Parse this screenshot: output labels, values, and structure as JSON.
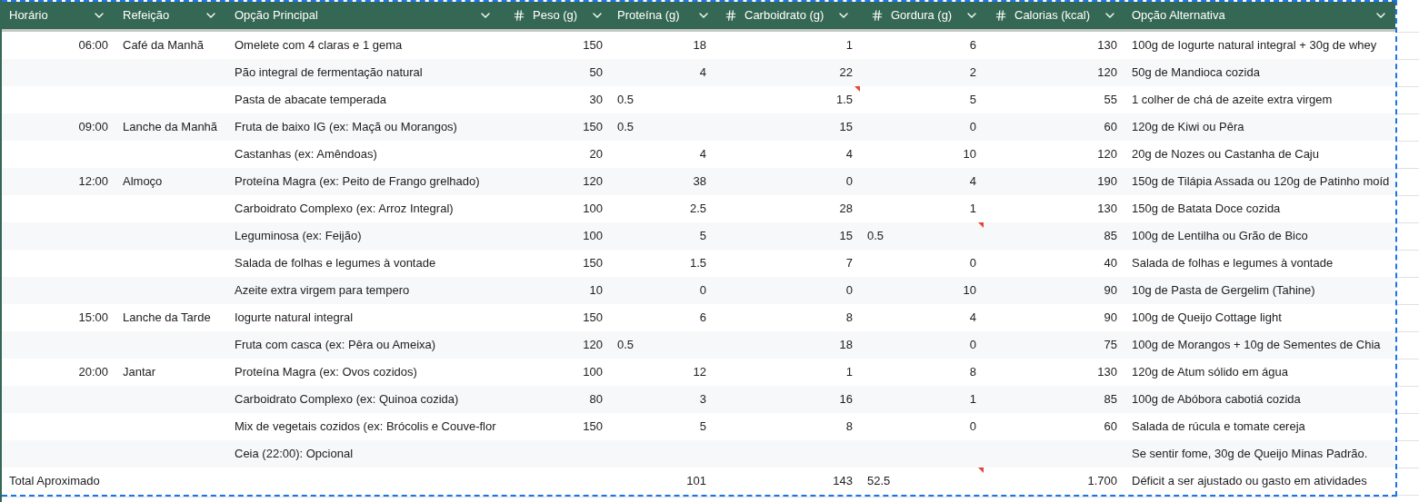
{
  "columns": [
    {
      "label": "Horário",
      "numeric": false
    },
    {
      "label": "Refeição",
      "numeric": false
    },
    {
      "label": "Opção Principal",
      "numeric": false
    },
    {
      "label": "Peso (g)",
      "numeric": true
    },
    {
      "label": "Proteína (g)",
      "numeric": false
    },
    {
      "label": "Carboidrato (g)",
      "numeric": true
    },
    {
      "label": "Gordura (g)",
      "numeric": true
    },
    {
      "label": "Calorias (kcal)",
      "numeric": true
    },
    {
      "label": "Opção Alternativa",
      "numeric": false
    }
  ],
  "rows": [
    {
      "cells": [
        {
          "text": "06:00",
          "kind": "number",
          "note": false
        },
        {
          "text": "Café da Manhã",
          "kind": "text",
          "note": false
        },
        {
          "text": "Omelete com 4 claras e 1 gema",
          "kind": "text",
          "note": false
        },
        {
          "text": "150",
          "kind": "number",
          "note": false
        },
        {
          "text": "18",
          "kind": "number",
          "note": false
        },
        {
          "text": "1",
          "kind": "number",
          "note": false
        },
        {
          "text": "6",
          "kind": "number",
          "note": false
        },
        {
          "text": "130",
          "kind": "number",
          "note": false
        },
        {
          "text": "100g de Iogurte natural integral + 30g de whey",
          "kind": "text",
          "note": false
        }
      ]
    },
    {
      "cells": [
        null,
        null,
        {
          "text": "Pão integral de fermentação natural",
          "kind": "text",
          "note": false
        },
        {
          "text": "50",
          "kind": "number",
          "note": false
        },
        {
          "text": "4",
          "kind": "number",
          "note": false
        },
        {
          "text": "22",
          "kind": "number",
          "note": false
        },
        {
          "text": "2",
          "kind": "number",
          "note": false
        },
        {
          "text": "120",
          "kind": "number",
          "note": false
        },
        {
          "text": "50g de Mandioca cozida",
          "kind": "text",
          "note": false
        }
      ]
    },
    {
      "cells": [
        null,
        null,
        {
          "text": "Pasta de abacate temperada",
          "kind": "text",
          "note": false
        },
        {
          "text": "30",
          "kind": "number",
          "note": false
        },
        {
          "text": "0.5",
          "kind": "text",
          "note": false
        },
        {
          "text": "1.5",
          "kind": "number",
          "note": true
        },
        {
          "text": "5",
          "kind": "number",
          "note": false
        },
        {
          "text": "55",
          "kind": "number",
          "note": false
        },
        {
          "text": "1 colher de chá de azeite extra virgem",
          "kind": "text",
          "note": false
        }
      ]
    },
    {
      "cells": [
        {
          "text": "09:00",
          "kind": "number",
          "note": false
        },
        {
          "text": "Lanche da Manhã",
          "kind": "text",
          "note": false
        },
        {
          "text": "Fruta de baixo IG (ex: Maçã ou Morangos)",
          "kind": "text",
          "note": false
        },
        {
          "text": "150",
          "kind": "number",
          "note": false
        },
        {
          "text": "0.5",
          "kind": "text",
          "note": false
        },
        {
          "text": "15",
          "kind": "number",
          "note": false
        },
        {
          "text": "0",
          "kind": "number",
          "note": false
        },
        {
          "text": "60",
          "kind": "number",
          "note": false
        },
        {
          "text": "120g de Kiwi ou Pêra",
          "kind": "text",
          "note": false
        }
      ]
    },
    {
      "cells": [
        null,
        null,
        {
          "text": "Castanhas (ex: Amêndoas)",
          "kind": "text",
          "note": false
        },
        {
          "text": "20",
          "kind": "number",
          "note": false
        },
        {
          "text": "4",
          "kind": "number",
          "note": false
        },
        {
          "text": "4",
          "kind": "number",
          "note": false
        },
        {
          "text": "10",
          "kind": "number",
          "note": false
        },
        {
          "text": "120",
          "kind": "number",
          "note": false
        },
        {
          "text": "20g de Nozes ou Castanha de Caju",
          "kind": "text",
          "note": false
        }
      ]
    },
    {
      "cells": [
        {
          "text": "12:00",
          "kind": "number",
          "note": false
        },
        {
          "text": "Almoço",
          "kind": "text",
          "note": false
        },
        {
          "text": "Proteína Magra (ex: Peito de Frango grelhado)",
          "kind": "text",
          "note": false
        },
        {
          "text": "120",
          "kind": "number",
          "note": false
        },
        {
          "text": "38",
          "kind": "number",
          "note": false
        },
        {
          "text": "0",
          "kind": "number",
          "note": false
        },
        {
          "text": "4",
          "kind": "number",
          "note": false
        },
        {
          "text": "190",
          "kind": "number",
          "note": false
        },
        {
          "text": "150g de Tilápia Assada ou 120g de Patinho moíd",
          "kind": "text",
          "note": false
        }
      ]
    },
    {
      "cells": [
        null,
        null,
        {
          "text": "Carboidrato Complexo (ex: Arroz Integral)",
          "kind": "text",
          "note": false
        },
        {
          "text": "100",
          "kind": "number",
          "note": false
        },
        {
          "text": "2.5",
          "kind": "number",
          "note": false
        },
        {
          "text": "28",
          "kind": "number",
          "note": false
        },
        {
          "text": "1",
          "kind": "number",
          "note": false
        },
        {
          "text": "130",
          "kind": "number",
          "note": false
        },
        {
          "text": "150g de Batata Doce cozida",
          "kind": "text",
          "note": false
        }
      ]
    },
    {
      "cells": [
        null,
        null,
        {
          "text": "Leguminosa (ex: Feijão)",
          "kind": "text",
          "note": false
        },
        {
          "text": "100",
          "kind": "number",
          "note": false
        },
        {
          "text": "5",
          "kind": "number",
          "note": false
        },
        {
          "text": "15",
          "kind": "number",
          "note": false
        },
        {
          "text": "0.5",
          "kind": "text",
          "note": true
        },
        {
          "text": "85",
          "kind": "number",
          "note": false
        },
        {
          "text": "100g de Lentilha ou Grão de Bico",
          "kind": "text",
          "note": false
        }
      ]
    },
    {
      "cells": [
        null,
        null,
        {
          "text": "Salada de folhas e legumes à vontade",
          "kind": "text",
          "note": false
        },
        {
          "text": "150",
          "kind": "number",
          "note": false
        },
        {
          "text": "1.5",
          "kind": "number",
          "note": false
        },
        {
          "text": "7",
          "kind": "number",
          "note": false
        },
        {
          "text": "0",
          "kind": "number",
          "note": false
        },
        {
          "text": "40",
          "kind": "number",
          "note": false
        },
        {
          "text": "Salada de folhas e legumes à vontade",
          "kind": "text",
          "note": false
        }
      ]
    },
    {
      "cells": [
        null,
        null,
        {
          "text": "Azeite extra virgem para tempero",
          "kind": "text",
          "note": false
        },
        {
          "text": "10",
          "kind": "number",
          "note": false
        },
        {
          "text": "0",
          "kind": "number",
          "note": false
        },
        {
          "text": "0",
          "kind": "number",
          "note": false
        },
        {
          "text": "10",
          "kind": "number",
          "note": false
        },
        {
          "text": "90",
          "kind": "number",
          "note": false
        },
        {
          "text": "10g de Pasta de Gergelim (Tahine)",
          "kind": "text",
          "note": false
        }
      ]
    },
    {
      "cells": [
        {
          "text": "15:00",
          "kind": "number",
          "note": false
        },
        {
          "text": "Lanche da Tarde",
          "kind": "text",
          "note": false
        },
        {
          "text": "Iogurte natural integral",
          "kind": "text",
          "note": false
        },
        {
          "text": "150",
          "kind": "number",
          "note": false
        },
        {
          "text": "6",
          "kind": "number",
          "note": false
        },
        {
          "text": "8",
          "kind": "number",
          "note": false
        },
        {
          "text": "4",
          "kind": "number",
          "note": false
        },
        {
          "text": "90",
          "kind": "number",
          "note": false
        },
        {
          "text": "100g de Queijo Cottage light",
          "kind": "text",
          "note": false
        }
      ]
    },
    {
      "cells": [
        null,
        null,
        {
          "text": "Fruta com casca (ex: Pêra ou Ameixa)",
          "kind": "text",
          "note": false
        },
        {
          "text": "120",
          "kind": "number",
          "note": false
        },
        {
          "text": "0.5",
          "kind": "text",
          "note": false
        },
        {
          "text": "18",
          "kind": "number",
          "note": false
        },
        {
          "text": "0",
          "kind": "number",
          "note": false
        },
        {
          "text": "75",
          "kind": "number",
          "note": false
        },
        {
          "text": "100g de Morangos + 10g de Sementes de Chia",
          "kind": "text",
          "note": false
        }
      ]
    },
    {
      "cells": [
        {
          "text": "20:00",
          "kind": "number",
          "note": false
        },
        {
          "text": "Jantar",
          "kind": "text",
          "note": false
        },
        {
          "text": "Proteína Magra (ex: Ovos cozidos)",
          "kind": "text",
          "note": false
        },
        {
          "text": "100",
          "kind": "number",
          "note": false
        },
        {
          "text": "12",
          "kind": "number",
          "note": false
        },
        {
          "text": "1",
          "kind": "number",
          "note": false
        },
        {
          "text": "8",
          "kind": "number",
          "note": false
        },
        {
          "text": "130",
          "kind": "number",
          "note": false
        },
        {
          "text": "120g de Atum sólido em água",
          "kind": "text",
          "note": false
        }
      ]
    },
    {
      "cells": [
        null,
        null,
        {
          "text": "Carboidrato Complexo (ex: Quinoa cozida)",
          "kind": "text",
          "note": false
        },
        {
          "text": "80",
          "kind": "number",
          "note": false
        },
        {
          "text": "3",
          "kind": "number",
          "note": false
        },
        {
          "text": "16",
          "kind": "number",
          "note": false
        },
        {
          "text": "1",
          "kind": "number",
          "note": false
        },
        {
          "text": "85",
          "kind": "number",
          "note": false
        },
        {
          "text": "100g de Abóbora cabotiá cozida",
          "kind": "text",
          "note": false
        }
      ]
    },
    {
      "cells": [
        null,
        null,
        {
          "text": "Mix de vegetais cozidos (ex: Brócolis e Couve-flor",
          "kind": "text",
          "note": false
        },
        {
          "text": "150",
          "kind": "number",
          "note": false
        },
        {
          "text": "5",
          "kind": "number",
          "note": false
        },
        {
          "text": "8",
          "kind": "number",
          "note": false
        },
        {
          "text": "0",
          "kind": "number",
          "note": false
        },
        {
          "text": "60",
          "kind": "number",
          "note": false
        },
        {
          "text": "Salada de rúcula e tomate cereja",
          "kind": "text",
          "note": false
        }
      ]
    },
    {
      "cells": [
        null,
        null,
        {
          "text": "Ceia (22:00): Opcional",
          "kind": "text",
          "note": false
        },
        null,
        null,
        null,
        null,
        null,
        {
          "text": "Se sentir fome, 30g de Queijo Minas Padrão.",
          "kind": "text",
          "note": false
        }
      ]
    },
    {
      "cells": [
        {
          "text": "Total Aproximado",
          "kind": "text",
          "note": false
        },
        null,
        null,
        null,
        {
          "text": "101",
          "kind": "number",
          "note": false
        },
        {
          "text": "143",
          "kind": "number",
          "note": false
        },
        {
          "text": "52.5",
          "kind": "text",
          "note": true
        },
        {
          "text": "1.700",
          "kind": "number",
          "note": false
        },
        {
          "text": "Déficit a ser ajustado ou gasto em atividades",
          "kind": "text",
          "note": false
        }
      ]
    }
  ]
}
